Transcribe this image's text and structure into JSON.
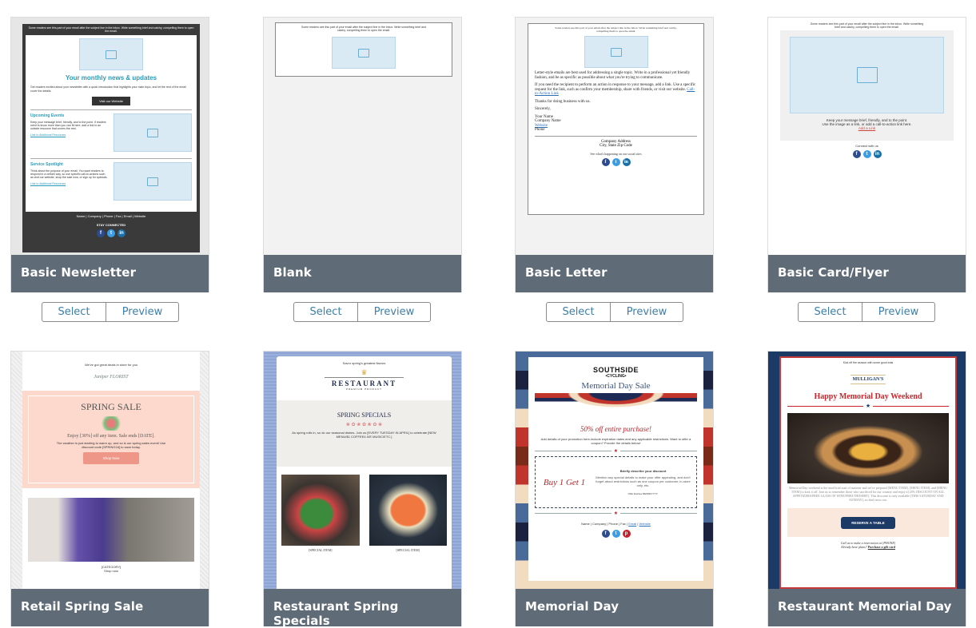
{
  "buttons": {
    "select": "Select",
    "preview": "Preview"
  },
  "templates": [
    {
      "name": "Basic Newsletter",
      "preheader": "Some readers see this part of your email after the subject line in the inbox. Write something brief and catchy, compelling them to open the email.",
      "headline": "Your monthly news & updates",
      "intro": "Get readers excited about your newsletter with a quick introduction that highlights your main topic, and let the rest of the email cover the details.",
      "cta": "Visit our Website",
      "section1_title": "Upcoming Events",
      "section1_body": "Keep your message brief, friendly, and to the point. If readers need to know more than you can fit here, add a link to an outside resource that covers the rest.",
      "section_link": "Link to Additional Resources",
      "section2_title": "Service Spotlight",
      "section2_body": "Think about the purpose of your email. You want readers to respond in a certain way, so use specific call-to-actions such as visit our website, shop the sale now, or sign up for specials.",
      "footer": "Name | Company | Phone | Fax | Email | Website",
      "stay": "STAY CONNECTED"
    },
    {
      "name": "Blank",
      "preheader": "Some readers see this part of your email after the subject line in the inbox. Write something brief and catchy, compelling them to open the email."
    },
    {
      "name": "Basic Letter",
      "preheader": "Some readers see this part of your email after the subject line in the inbox. Write something brief and catchy, compelling them to open the email.",
      "p1": "Letter-style emails are best used for addressing a single topic. Write in a professional yet friendly fashion, and be as specific as possible about what you're trying to communicate.",
      "p2": "If you need the recipient to perform an action in response to your message, add a link. Use a specific request for the link, such as confirm your membership, share with friends, or visit our website.",
      "p2_link": "Call-to-Action Link",
      "p3": "Thanks for doing business with us.",
      "signoff": "Sincerely,",
      "sig_name": "Your Name",
      "sig_company": "Company Name",
      "sig_website": "Website",
      "sig_phone": "Phone",
      "address1": "Company Address",
      "address2": "City, State Zip Code",
      "social": "See what's happening on our social sites"
    },
    {
      "name": "Basic Card/Flyer",
      "preheader": "Some readers see this part of your email after the subject line in the inbox. Write something brief and catchy, compelling them to open the email.",
      "body1": "Keep your message brief, friendly, and to the point.",
      "body2": "Use the image as a link, or add a call-to-action link here.",
      "link": "Add a Link",
      "connect": "Connect with us"
    },
    {
      "name": "Retail Spring Sale",
      "preheader": "We've got great deals in store for you",
      "logo": "Juniper FLORIST",
      "headline": "SPRING SALE",
      "offer": "Enjoy [30%] off any item. Sale ends [DATE].",
      "body": "The weather is just starting to warm up, and so is our spring sales event! Use discount code [SPRING16] to save today.",
      "cta": "Shop Now",
      "category": "[CATEGORY]",
      "shop": "Shop now"
    },
    {
      "name": "Restaurant Spring Specials",
      "preheader": "Savor spring's greatest flavors",
      "logo": "RESTAURANT",
      "logo_sub": "PREMIUM PRODUCT",
      "headline": "SPRING SPECIALS",
      "body": "As spring rolls in, so do our seasonal dishes. Join us [EVERY TUESDAY IN APRIL] to celebrate [NEW MENU/$1 COFFEE/LIVE MUSIC/ETC.]",
      "item1": "[SPECIAL ITEM]",
      "item2": "[SPECIAL ITEM]"
    },
    {
      "name": "Memorial Day",
      "logo1": "SOUTHSIDE",
      "logo2": "•CYCLING•",
      "headline": "Memorial Day Sale",
      "offer": "50% off entire purchase!",
      "body": "Add details of your promotion here-include expiration dates and any applicable restrictions. Want to offer a coupon? Provide the details below!",
      "coupon_big": "Buy 1 Get 1",
      "coupon_title": "Briefly describe your discount",
      "coupon_body": "Mention any special details to make your offer appealing, and don't forget about restrictions such as one coupon per customer, in-store only, etc.",
      "coupon_exp": "Offer Expires MM/DD/YYYY.",
      "footer": "Name | Company | Phone | Fax |",
      "footer_email": "Email",
      "footer_website": "Website"
    },
    {
      "name": "Restaurant Memorial Day",
      "preheader": "Kick off the season with some good eats",
      "logo": "MULLIGAN'S",
      "headline": "Happy Memorial Day Weekend",
      "body": "Memorial Day weekend is the unofficial start of summer and we've prepared [MENU ITEM], [MENU ITEM], and [MENU ITEM] to kick it off. Join us to remember those who sacrificed for our country and enjoy a [25% DISCOUNT ON ALL APPETIZERS/FREE GLASS OF WINE/FREE DESSERT]. This discount is only available [THIS SATURDAY AND SUNDAY], so don't miss out.",
      "cta": "RESERVE A TABLE",
      "call": "Call us to make a reservation at [PHONE]",
      "plans": "Already have plans?",
      "gift": "Purchase a gift card"
    }
  ],
  "colors": {
    "caption_bar": "#5f6b77",
    "button_text": "#3d7fa8",
    "newsletter_accent": "#2a9bb8",
    "memorial_red": "#b5262c",
    "navy": "#1c3a66"
  }
}
